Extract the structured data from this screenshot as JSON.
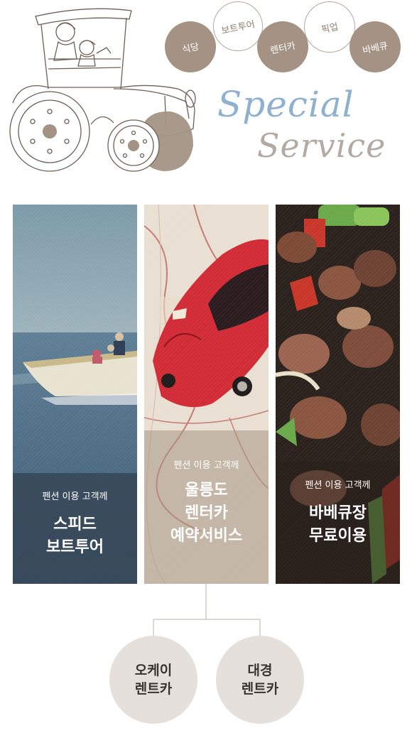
{
  "header": {
    "bubbles": {
      "restaurant": "식당",
      "boat_tour": "보트투어",
      "rent_car": "렌터카",
      "pickup": "픽업",
      "barbecue": "바베큐"
    },
    "title_line1": "Special",
    "title_line2": "Service"
  },
  "services": [
    {
      "sub": "펜션 이용 고객께",
      "line1": "스피드",
      "line2": "보트투어"
    },
    {
      "sub": "펜션 이용 고객께",
      "line1": "울릉도",
      "line2": "렌터카",
      "line3": "예약서비스"
    },
    {
      "sub": "펜션 이용 고객께",
      "line1": "바베큐장",
      "line2": "무료이용"
    }
  ],
  "rentals": [
    {
      "line1": "오케이",
      "line2": "렌트카"
    },
    {
      "line1": "대경",
      "line2": "렌트카"
    }
  ],
  "colors": {
    "accent_brown": "#a49384",
    "title_blue": "#8fb0cf",
    "title_gray": "#b3aba3",
    "rental_bg": "#e5e0dc"
  }
}
